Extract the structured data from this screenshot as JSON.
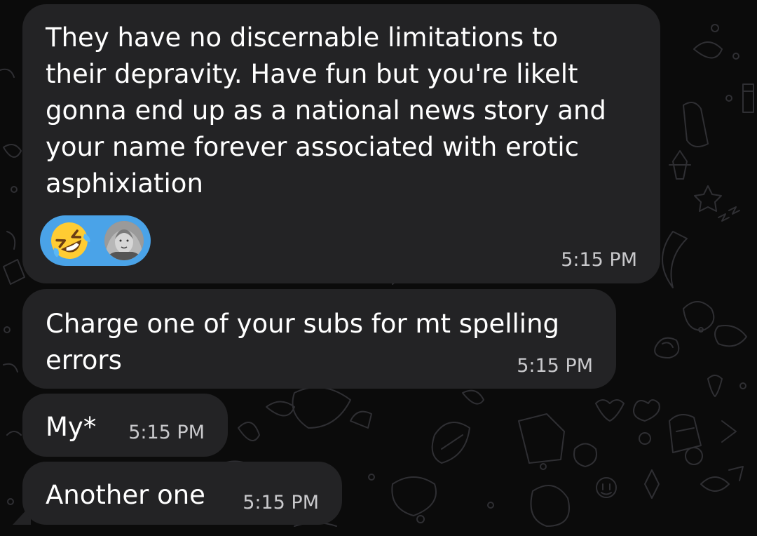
{
  "messages": [
    {
      "lines": [
        "They have no discernable limitations to",
        "their depravity. Have fun but you're likelt",
        "gonna end up as a national news story and",
        "your name forever associated with erotic",
        "asphixiation"
      ],
      "time": "5:15 PM",
      "reactions": [
        {
          "icon": "rolling-laughing-emoji"
        },
        {
          "icon": "reactor-avatar"
        }
      ]
    },
    {
      "lines": [
        "Charge one of your subs for mt spelling",
        "errors"
      ],
      "time": "5:15 PM"
    },
    {
      "lines": [
        "My*"
      ],
      "time": "5:15 PM"
    },
    {
      "lines": [
        "Another one"
      ],
      "time": "5:15 PM"
    }
  ],
  "colors": {
    "background": "#0b0b0b",
    "bubble": "#232325",
    "reaction_pill": "#4aa3e8",
    "timestamp": "#c9c9cc",
    "text": "#ffffff"
  }
}
